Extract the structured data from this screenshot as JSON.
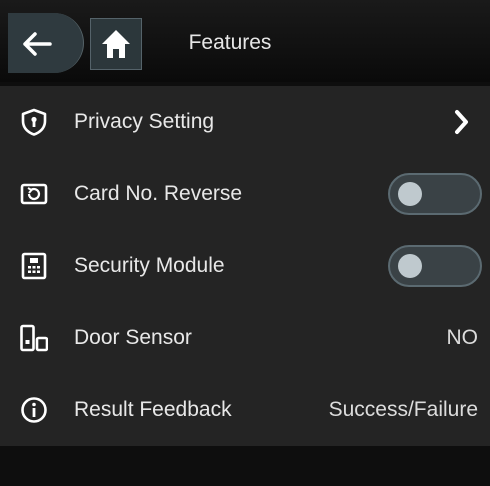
{
  "header": {
    "title": "Features",
    "back_icon": "arrow-left-icon",
    "home_icon": "home-icon"
  },
  "colors": {
    "background": "#0e0e0e",
    "row_background": "#242424",
    "toggle_track": "#3a4246",
    "toggle_knob": "#bfc9ce"
  },
  "rows": [
    {
      "label": "Privacy Setting",
      "icon": "shield-icon",
      "control": "chevron"
    },
    {
      "label": "Card No. Reverse",
      "icon": "card-reverse-icon",
      "control": "toggle",
      "enabled": false
    },
    {
      "label": "Security Module",
      "icon": "security-module-icon",
      "control": "toggle",
      "enabled": false
    },
    {
      "label": "Door Sensor",
      "icon": "door-sensor-icon",
      "control": "value",
      "value": "NO"
    },
    {
      "label": "Result Feedback",
      "icon": "info-icon",
      "control": "value",
      "value": "Success/Failure"
    }
  ]
}
